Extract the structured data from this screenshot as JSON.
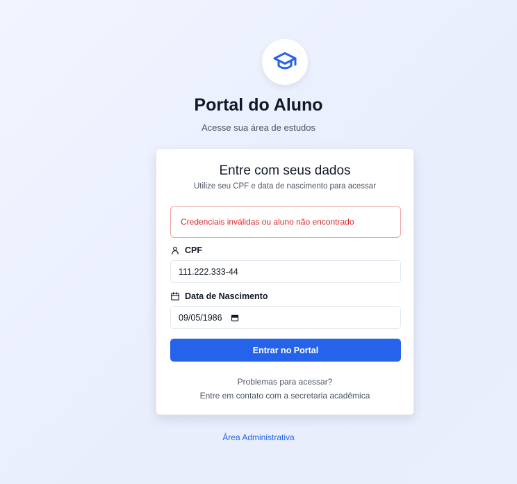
{
  "header": {
    "logo_icon": "graduation-cap-icon",
    "title": "Portal do Aluno",
    "subtitle": "Acesse sua área de estudos"
  },
  "card": {
    "title": "Entre com seus dados",
    "subtitle": "Utilize seu CPF e data de nascimento para acessar",
    "error_message": "Credenciais inválidas ou aluno não encontrado",
    "cpf": {
      "label": "CPF",
      "icon": "user-icon",
      "value": "111.222.333-44"
    },
    "birthdate": {
      "label": "Data de Nascimento",
      "icon": "calendar-icon",
      "value": "09/05/1986"
    },
    "submit_label": "Entrar no Portal",
    "help_question": "Problemas para acessar?",
    "help_contact": "Entre em contato com a secretaria acadêmica"
  },
  "footer": {
    "admin_link": "Área Administrativa"
  },
  "colors": {
    "accent": "#2563eb",
    "error": "#dc2626",
    "error_border": "#f2a3a3"
  }
}
